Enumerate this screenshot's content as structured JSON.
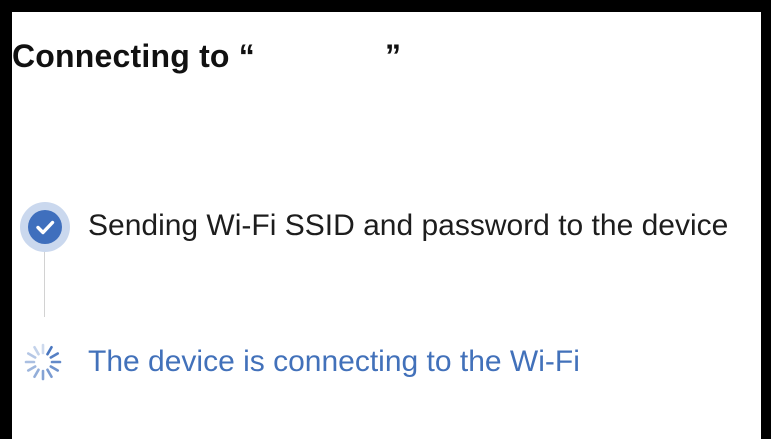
{
  "page": {
    "title_prefix": "Connecting to “",
    "title_suffix": "”"
  },
  "steps": [
    {
      "label": "Sending Wi-Fi SSID and password to the device",
      "status": "done",
      "icon": "checkmark-circle-icon"
    },
    {
      "label": "The device is connecting to the Wi-Fi",
      "status": "in-progress",
      "icon": "spinner-icon"
    }
  ],
  "colors": {
    "accent": "#3f6fbd",
    "accent_ring": "#cad8ee",
    "active_text": "#4271ba",
    "text": "#1d1d1d",
    "frame": "#000000"
  }
}
